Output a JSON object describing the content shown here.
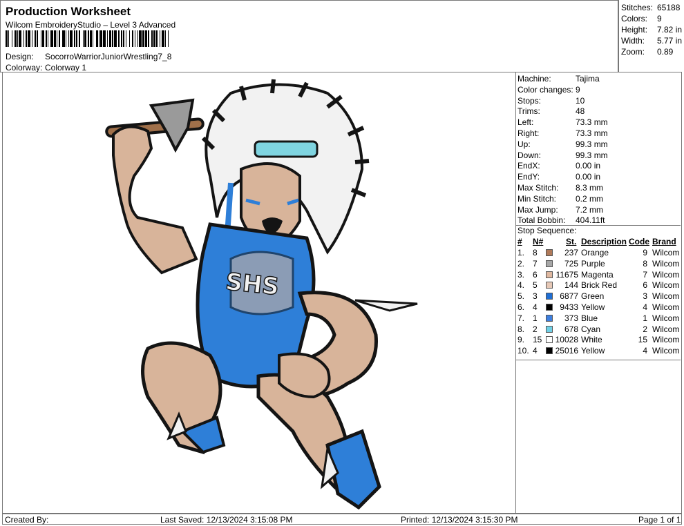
{
  "header": {
    "title": "Production Worksheet",
    "subtitle": "Wilcom EmbroideryStudio – Level 3 Advanced",
    "design_label": "Design:",
    "design_value": "SocorroWarriorJuniorWrestling7_8",
    "colorway_label": "Colorway:",
    "colorway_value": "Colorway 1"
  },
  "stats": [
    {
      "label": "Stitches:",
      "value": "65188"
    },
    {
      "label": "Colors:",
      "value": "9"
    },
    {
      "label": "Height:",
      "value": "7.82 in"
    },
    {
      "label": "Width:",
      "value": "5.77 in"
    },
    {
      "label": "Zoom:",
      "value": "0.89"
    }
  ],
  "info": [
    {
      "label": "Machine:",
      "value": "Tajima"
    },
    {
      "label": "Color changes:",
      "value": "9"
    },
    {
      "label": "Stops:",
      "value": "10"
    },
    {
      "label": "Trims:",
      "value": "48"
    },
    {
      "label": "Left:",
      "value": "73.3 mm"
    },
    {
      "label": "Right:",
      "value": "73.3 mm"
    },
    {
      "label": "Up:",
      "value": "99.3 mm"
    },
    {
      "label": "Down:",
      "value": "99.3 mm"
    },
    {
      "label": "EndX:",
      "value": "0.00 in"
    },
    {
      "label": "EndY:",
      "value": "0.00 in"
    },
    {
      "label": "Max Stitch:",
      "value": "8.3 mm"
    },
    {
      "label": "Min Stitch:",
      "value": "0.2 mm"
    },
    {
      "label": "Max Jump:",
      "value": "7.2 mm"
    },
    {
      "label": "Total Bobbin:",
      "value": "404.11ft"
    }
  ],
  "stop_sequence": {
    "title": "Stop Sequence:",
    "headers": {
      "num": "#",
      "n": "N#",
      "st": "St.",
      "desc": "Description",
      "code": "Code",
      "brand": "Brand"
    },
    "rows": [
      {
        "num": "1.",
        "n": "8",
        "color": "#b07a5a",
        "st": "237",
        "desc": "Orange",
        "code": "9",
        "brand": "Wilcom"
      },
      {
        "num": "2.",
        "n": "7",
        "color": "#a7a7a7",
        "st": "725",
        "desc": "Purple",
        "code": "8",
        "brand": "Wilcom"
      },
      {
        "num": "3.",
        "n": "6",
        "color": "#dfb8a0",
        "st": "11675",
        "desc": "Magenta",
        "code": "7",
        "brand": "Wilcom"
      },
      {
        "num": "4.",
        "n": "5",
        "color": "#e6c8b6",
        "st": "144",
        "desc": "Brick Red",
        "code": "6",
        "brand": "Wilcom"
      },
      {
        "num": "5.",
        "n": "3",
        "color": "#1f6ed4",
        "st": "6877",
        "desc": "Green",
        "code": "3",
        "brand": "Wilcom"
      },
      {
        "num": "6.",
        "n": "4",
        "color": "#000000",
        "st": "9433",
        "desc": "Yellow",
        "code": "4",
        "brand": "Wilcom"
      },
      {
        "num": "7.",
        "n": "1",
        "color": "#3d7fe0",
        "st": "373",
        "desc": "Blue",
        "code": "1",
        "brand": "Wilcom"
      },
      {
        "num": "8.",
        "n": "2",
        "color": "#6fd0e6",
        "st": "678",
        "desc": "Cyan",
        "code": "2",
        "brand": "Wilcom"
      },
      {
        "num": "9.",
        "n": "15",
        "color": "#ffffff",
        "st": "10028",
        "desc": "White",
        "code": "15",
        "brand": "Wilcom"
      },
      {
        "num": "10.",
        "n": "4",
        "color": "#000000",
        "st": "25016",
        "desc": "Yellow",
        "code": "4",
        "brand": "Wilcom"
      }
    ]
  },
  "footer": {
    "created_by": "Created By:",
    "last_saved": "Last Saved: 12/13/2024 3:15:08 PM",
    "printed": "Printed: 12/13/2024 3:15:30 PM",
    "page": "Page 1 of 1"
  },
  "design_image": {
    "jersey_text": "SHS",
    "colors": {
      "skin": "#d8b49a",
      "blue": "#2e7fd8",
      "cyan": "#7fd4e0",
      "black": "#141414",
      "white": "#f2f2f2",
      "gray": "#9a9a9a",
      "wood": "#a0704a"
    }
  }
}
